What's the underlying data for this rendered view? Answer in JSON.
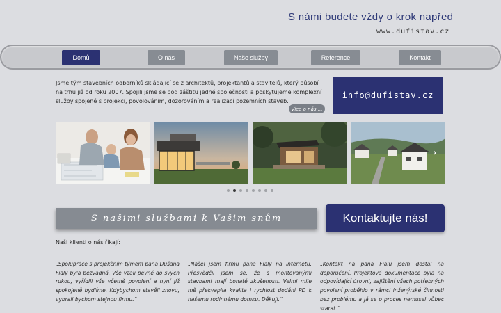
{
  "header": {
    "tagline": "S námi budete vždy o krok napřed",
    "website": "www.dufistav.cz"
  },
  "nav": {
    "items": [
      {
        "label": "Domů",
        "active": true
      },
      {
        "label": "O nás",
        "active": false
      },
      {
        "label": "Naše služby",
        "active": false
      },
      {
        "label": "Reference",
        "active": false
      },
      {
        "label": "Kontakt",
        "active": false
      }
    ]
  },
  "intro": {
    "text": "Jsme tým stavebních odborníků skládající se z architektů, projektantů a stavitelů, který působí na trhu již od roku 2007. Spojili jsme se pod záštitu jedné společnosti a poskytujeme komplexní služby spojené s projekcí, povolováním, dozorováním a realizací pozemních staveb.",
    "more_label": "Více o nás ..."
  },
  "email": "info@dufistav.cz",
  "slider": {
    "next_icon": "›",
    "dot_count": 8,
    "active_dot": 1
  },
  "services_banner": "S našimi službami k Vašim snům",
  "contact_button": "Kontaktujte nás!",
  "clients_heading": "Naši klienti o nás říkají:",
  "testimonials": [
    "„Spolupráce s projekčním týmem pana Dušana Fialy byla bezvadná. Vše vzali pevně do svých rukou, vyřídili vše včetně povolení a nyní již spokojeně bydlíme. Kdybychom stavěli znovu, vybrali bychom stejnou firmu.“",
    "„Našel jsem firmu pana Fialy na internetu. Přesvědčil jsem se, že s montovanými stavbami mají bohaté zkušenosti. Velmi mile mě překvapila kvalita i rychlost dodání PD k našemu rodinnému domku. Děkuji.“",
    "„Kontakt na pana Fialu jsem dostal na doporučení. Projektová dokumentace byla na odpovídající úrovni, zajištění všech potřebných povolení proběhlo v rámci inženýrské činnosti bez problému a já se o proces nemusel vůbec starat.“"
  ],
  "colors": {
    "primary": "#2b3172",
    "secondary": "#878c93",
    "background": "#dcdde1"
  }
}
